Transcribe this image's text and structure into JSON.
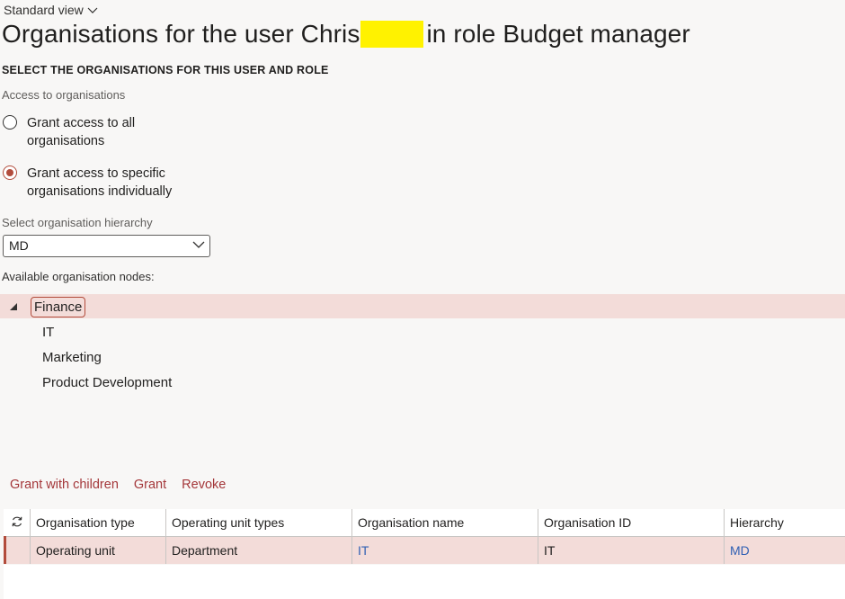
{
  "header": {
    "view_label": "Standard view",
    "title_prefix": "Organisations for the user Chris",
    "title_suffix": "in role Budget manager"
  },
  "section": {
    "title": "SELECT THE ORGANISATIONS FOR THIS USER AND ROLE"
  },
  "access": {
    "label": "Access to organisations",
    "options": [
      {
        "label": "Grant access to all organisations",
        "selected": false
      },
      {
        "label": "Grant access to specific organisations individually",
        "selected": true
      }
    ]
  },
  "hierarchy": {
    "label": "Select organisation hierarchy",
    "value": "MD"
  },
  "tree": {
    "label": "Available organisation nodes:",
    "root": "Finance",
    "children": [
      "IT",
      "Marketing",
      "Product Development"
    ]
  },
  "actions": [
    "Grant with children",
    "Grant",
    "Revoke"
  ],
  "grid": {
    "columns": [
      "Organisation type",
      "Operating unit types",
      "Organisation name",
      "Organisation ID",
      "Hierarchy"
    ],
    "rows": [
      {
        "type": "Operating unit",
        "unit_type": "Department",
        "name": "IT",
        "id": "IT",
        "hierarchy": "MD"
      }
    ]
  },
  "colors": {
    "accent": "#b24c3c",
    "selection": "#f3dcd9",
    "link": "#2f5fb3"
  },
  "icons": {
    "view_dropdown": "chevron-down-icon",
    "select_dropdown": "chevron-down-icon",
    "tree_expand": "caret-expanded-icon",
    "grid_refresh": "refresh-icon"
  }
}
